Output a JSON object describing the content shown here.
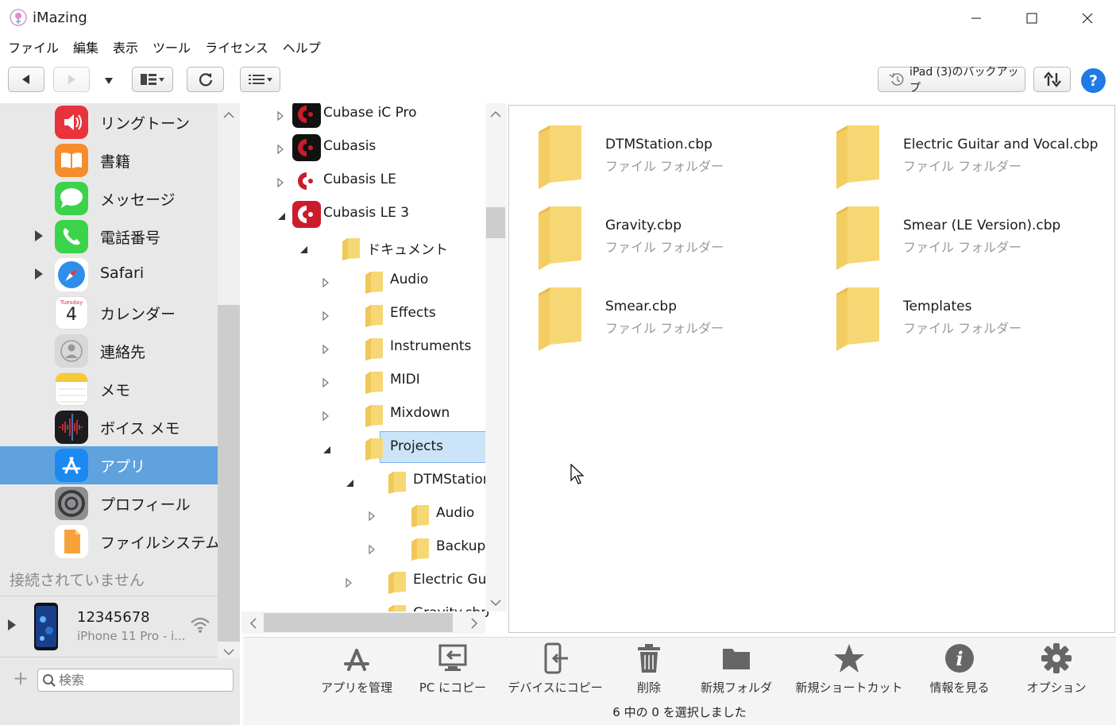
{
  "window": {
    "title": "iMazing"
  },
  "menu": [
    "ファイル",
    "編集",
    "表示",
    "ツール",
    "ライセンス",
    "ヘルプ"
  ],
  "toolbar": {
    "backup_label": "iPad (3)のバックアップ",
    "help_label": "?"
  },
  "sidebar": {
    "items": [
      {
        "label": "リングトーン",
        "icon": "ringtone-icon",
        "expandable": false,
        "selected": false
      },
      {
        "label": "書籍",
        "icon": "books-icon",
        "expandable": false,
        "selected": false
      },
      {
        "label": "メッセージ",
        "icon": "messages-icon",
        "expandable": false,
        "selected": false
      },
      {
        "label": "電話番号",
        "icon": "phone-icon",
        "expandable": true,
        "selected": false
      },
      {
        "label": "Safari",
        "icon": "safari-icon",
        "expandable": true,
        "selected": false
      },
      {
        "label": "カレンダー",
        "icon": "calendar-icon",
        "expandable": false,
        "selected": false
      },
      {
        "label": "連絡先",
        "icon": "contacts-icon",
        "expandable": false,
        "selected": false
      },
      {
        "label": "メモ",
        "icon": "notes-icon",
        "expandable": false,
        "selected": false
      },
      {
        "label": "ボイス メモ",
        "icon": "voice-memo-icon",
        "expandable": false,
        "selected": false
      },
      {
        "label": "アプリ",
        "icon": "app-store-icon",
        "expandable": false,
        "selected": true
      },
      {
        "label": "プロフィール",
        "icon": "profile-gear-icon",
        "expandable": false,
        "selected": false
      },
      {
        "label": "ファイルシステム",
        "icon": "file-system-icon",
        "expandable": false,
        "selected": false
      }
    ],
    "calendar_day": "Tuesday",
    "calendar_date": "4",
    "disconnected_label": "接続されていません",
    "device": {
      "name": "12345678",
      "model": "iPhone 11 Pro - i..."
    },
    "search_placeholder": "検索",
    "add_label": "+"
  },
  "tree": {
    "rows": [
      {
        "label": "Cubase iC Pro",
        "depth": 0,
        "arrow": "collapsed",
        "icon": "cubase-icon"
      },
      {
        "label": "Cubasis",
        "depth": 0,
        "arrow": "collapsed",
        "icon": "cubasis-icon"
      },
      {
        "label": "Cubasis LE",
        "depth": 0,
        "arrow": "collapsed",
        "icon": "cubasis-le-icon"
      },
      {
        "label": "Cubasis LE 3",
        "depth": 0,
        "arrow": "expanded",
        "icon": "cubasis-le3-icon"
      },
      {
        "label": "ドキュメント",
        "depth": 1,
        "arrow": "expanded",
        "icon": "folder-icon"
      },
      {
        "label": "Audio",
        "depth": 2,
        "arrow": "collapsed",
        "icon": "folder-icon"
      },
      {
        "label": "Effects",
        "depth": 2,
        "arrow": "collapsed",
        "icon": "folder-icon"
      },
      {
        "label": "Instruments",
        "depth": 2,
        "arrow": "collapsed",
        "icon": "folder-icon"
      },
      {
        "label": "MIDI",
        "depth": 2,
        "arrow": "collapsed",
        "icon": "folder-icon"
      },
      {
        "label": "Mixdown",
        "depth": 2,
        "arrow": "collapsed",
        "icon": "folder-icon"
      },
      {
        "label": "Projects",
        "depth": 2,
        "arrow": "expanded",
        "icon": "folder-icon",
        "selected": true
      },
      {
        "label": "DTMStation.cb",
        "depth": 3,
        "arrow": "expanded",
        "icon": "folder-icon"
      },
      {
        "label": "Audio",
        "depth": 4,
        "arrow": "collapsed",
        "icon": "folder-icon"
      },
      {
        "label": "Backup",
        "depth": 4,
        "arrow": "collapsed",
        "icon": "folder-icon"
      },
      {
        "label": "Electric Guitar..",
        "depth": 3,
        "arrow": "collapsed",
        "icon": "folder-icon"
      },
      {
        "label": "Gravity.cbp",
        "depth": 3,
        "arrow": "collapsed",
        "icon": "folder-icon"
      }
    ]
  },
  "content": {
    "items": [
      {
        "name": "DTMStation.cbp",
        "type": "ファイル フォルダー"
      },
      {
        "name": "Electric Guitar and Vocal.cbp",
        "type": "ファイル フォルダー"
      },
      {
        "name": "Gravity.cbp",
        "type": "ファイル フォルダー"
      },
      {
        "name": "Smear (LE Version).cbp",
        "type": "ファイル フォルダー"
      },
      {
        "name": "Smear.cbp",
        "type": "ファイル フォルダー"
      },
      {
        "name": "Templates",
        "type": "ファイル フォルダー"
      }
    ]
  },
  "actions": [
    {
      "label": "アプリを管理",
      "icon": "manage-apps-icon"
    },
    {
      "label": "PC にコピー",
      "icon": "copy-to-pc-icon"
    },
    {
      "label": "デバイスにコピー",
      "icon": "copy-to-device-icon"
    },
    {
      "label": "削除",
      "icon": "trash-icon"
    },
    {
      "label": "新規フォルダ",
      "icon": "new-folder-icon"
    },
    {
      "label": "新規ショートカット",
      "icon": "star-icon"
    },
    {
      "label": "情報を見る",
      "icon": "info-icon"
    },
    {
      "label": "オプション",
      "icon": "gear-icon"
    }
  ],
  "status": "6 中の 0 を選択しました",
  "colors": {
    "selection": "#5fa2de",
    "tree_selection": "#cce4f7",
    "folder": "#f7d774",
    "help": "#1e7be6"
  }
}
